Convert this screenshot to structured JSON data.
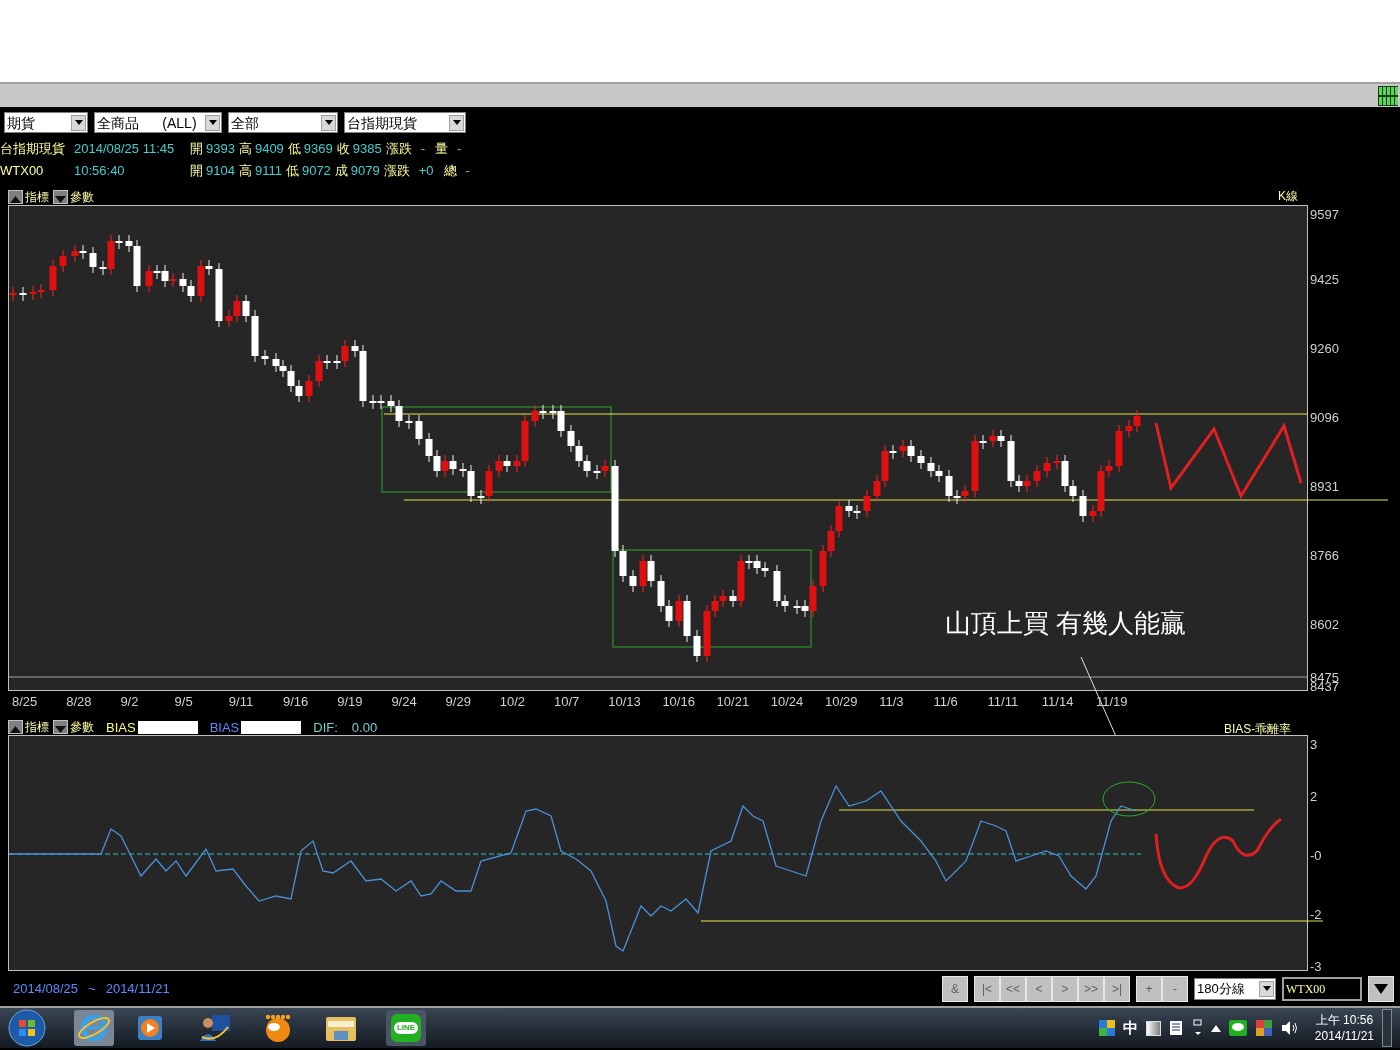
{
  "toolbar": {
    "dropdowns": [
      {
        "value": "期貨"
      },
      {
        "value": "全商品      (ALL)"
      },
      {
        "value": "全部"
      },
      {
        "value": "台指期現貨"
      }
    ]
  },
  "quotes": [
    {
      "name": "台指期現貨",
      "time": "2014/08/25 11:45",
      "fields": [
        {
          "label": "開",
          "value": "9393"
        },
        {
          "label": "高",
          "value": "9409"
        },
        {
          "label": "低",
          "value": "9369"
        },
        {
          "label": "收",
          "value": "9385"
        },
        {
          "label": "漲跌",
          "value": "-"
        },
        {
          "label": "量",
          "value": "-"
        }
      ]
    },
    {
      "name": "WTX00",
      "time": "10:56:40",
      "fields": [
        {
          "label": "開",
          "value": "9104"
        },
        {
          "label": "高",
          "value": "9111"
        },
        {
          "label": "低",
          "value": "9072"
        },
        {
          "label": "成",
          "value": "9079"
        },
        {
          "label": "漲跌",
          "value": "+0"
        },
        {
          "label": "總",
          "value": "-"
        }
      ]
    }
  ],
  "main_chart": {
    "buttons": [
      "指標",
      "參數"
    ],
    "type_label": "K線",
    "yticks": [
      "9597",
      "9425",
      "9260",
      "9096",
      "8931",
      "8766",
      "8602",
      "8475",
      "8437"
    ],
    "xlabels": [
      "8/25",
      "8/28",
      "9/2",
      "9/5",
      "9/11",
      "9/16",
      "9/19",
      "9/24",
      "9/29",
      "10/2",
      "10/7",
      "10/13",
      "10/16",
      "10/21",
      "10/24",
      "10/29",
      "11/3",
      "11/6",
      "11/11",
      "11/14",
      "11/19"
    ],
    "annotation": "山頂上買 有幾人能贏"
  },
  "indicator": {
    "buttons": [
      "指標",
      "參數"
    ],
    "legend": [
      {
        "label": "BIAS",
        "color": "#ffff66"
      },
      {
        "label": "BIAS",
        "color": "#5a8cff"
      }
    ],
    "dif_label": "DIF:",
    "dif_value": "0.00",
    "type_label": "BIAS-乖離率",
    "yticks": [
      "3",
      "2",
      "-0",
      "-2",
      "-3"
    ]
  },
  "footer": {
    "range_start": "2014/08/25",
    "range_sep": "~",
    "range_end": "2014/11/21",
    "nav_buttons": [
      "&",
      "|<",
      "<<",
      "<",
      ">",
      ">>",
      ">|",
      "+",
      "-"
    ],
    "period": "180分線",
    "symbol": "WTX00"
  },
  "taskbar": {
    "line_label": "LINE",
    "ime": "中",
    "time": "上午 10:56",
    "date": "2014/11/21"
  }
}
